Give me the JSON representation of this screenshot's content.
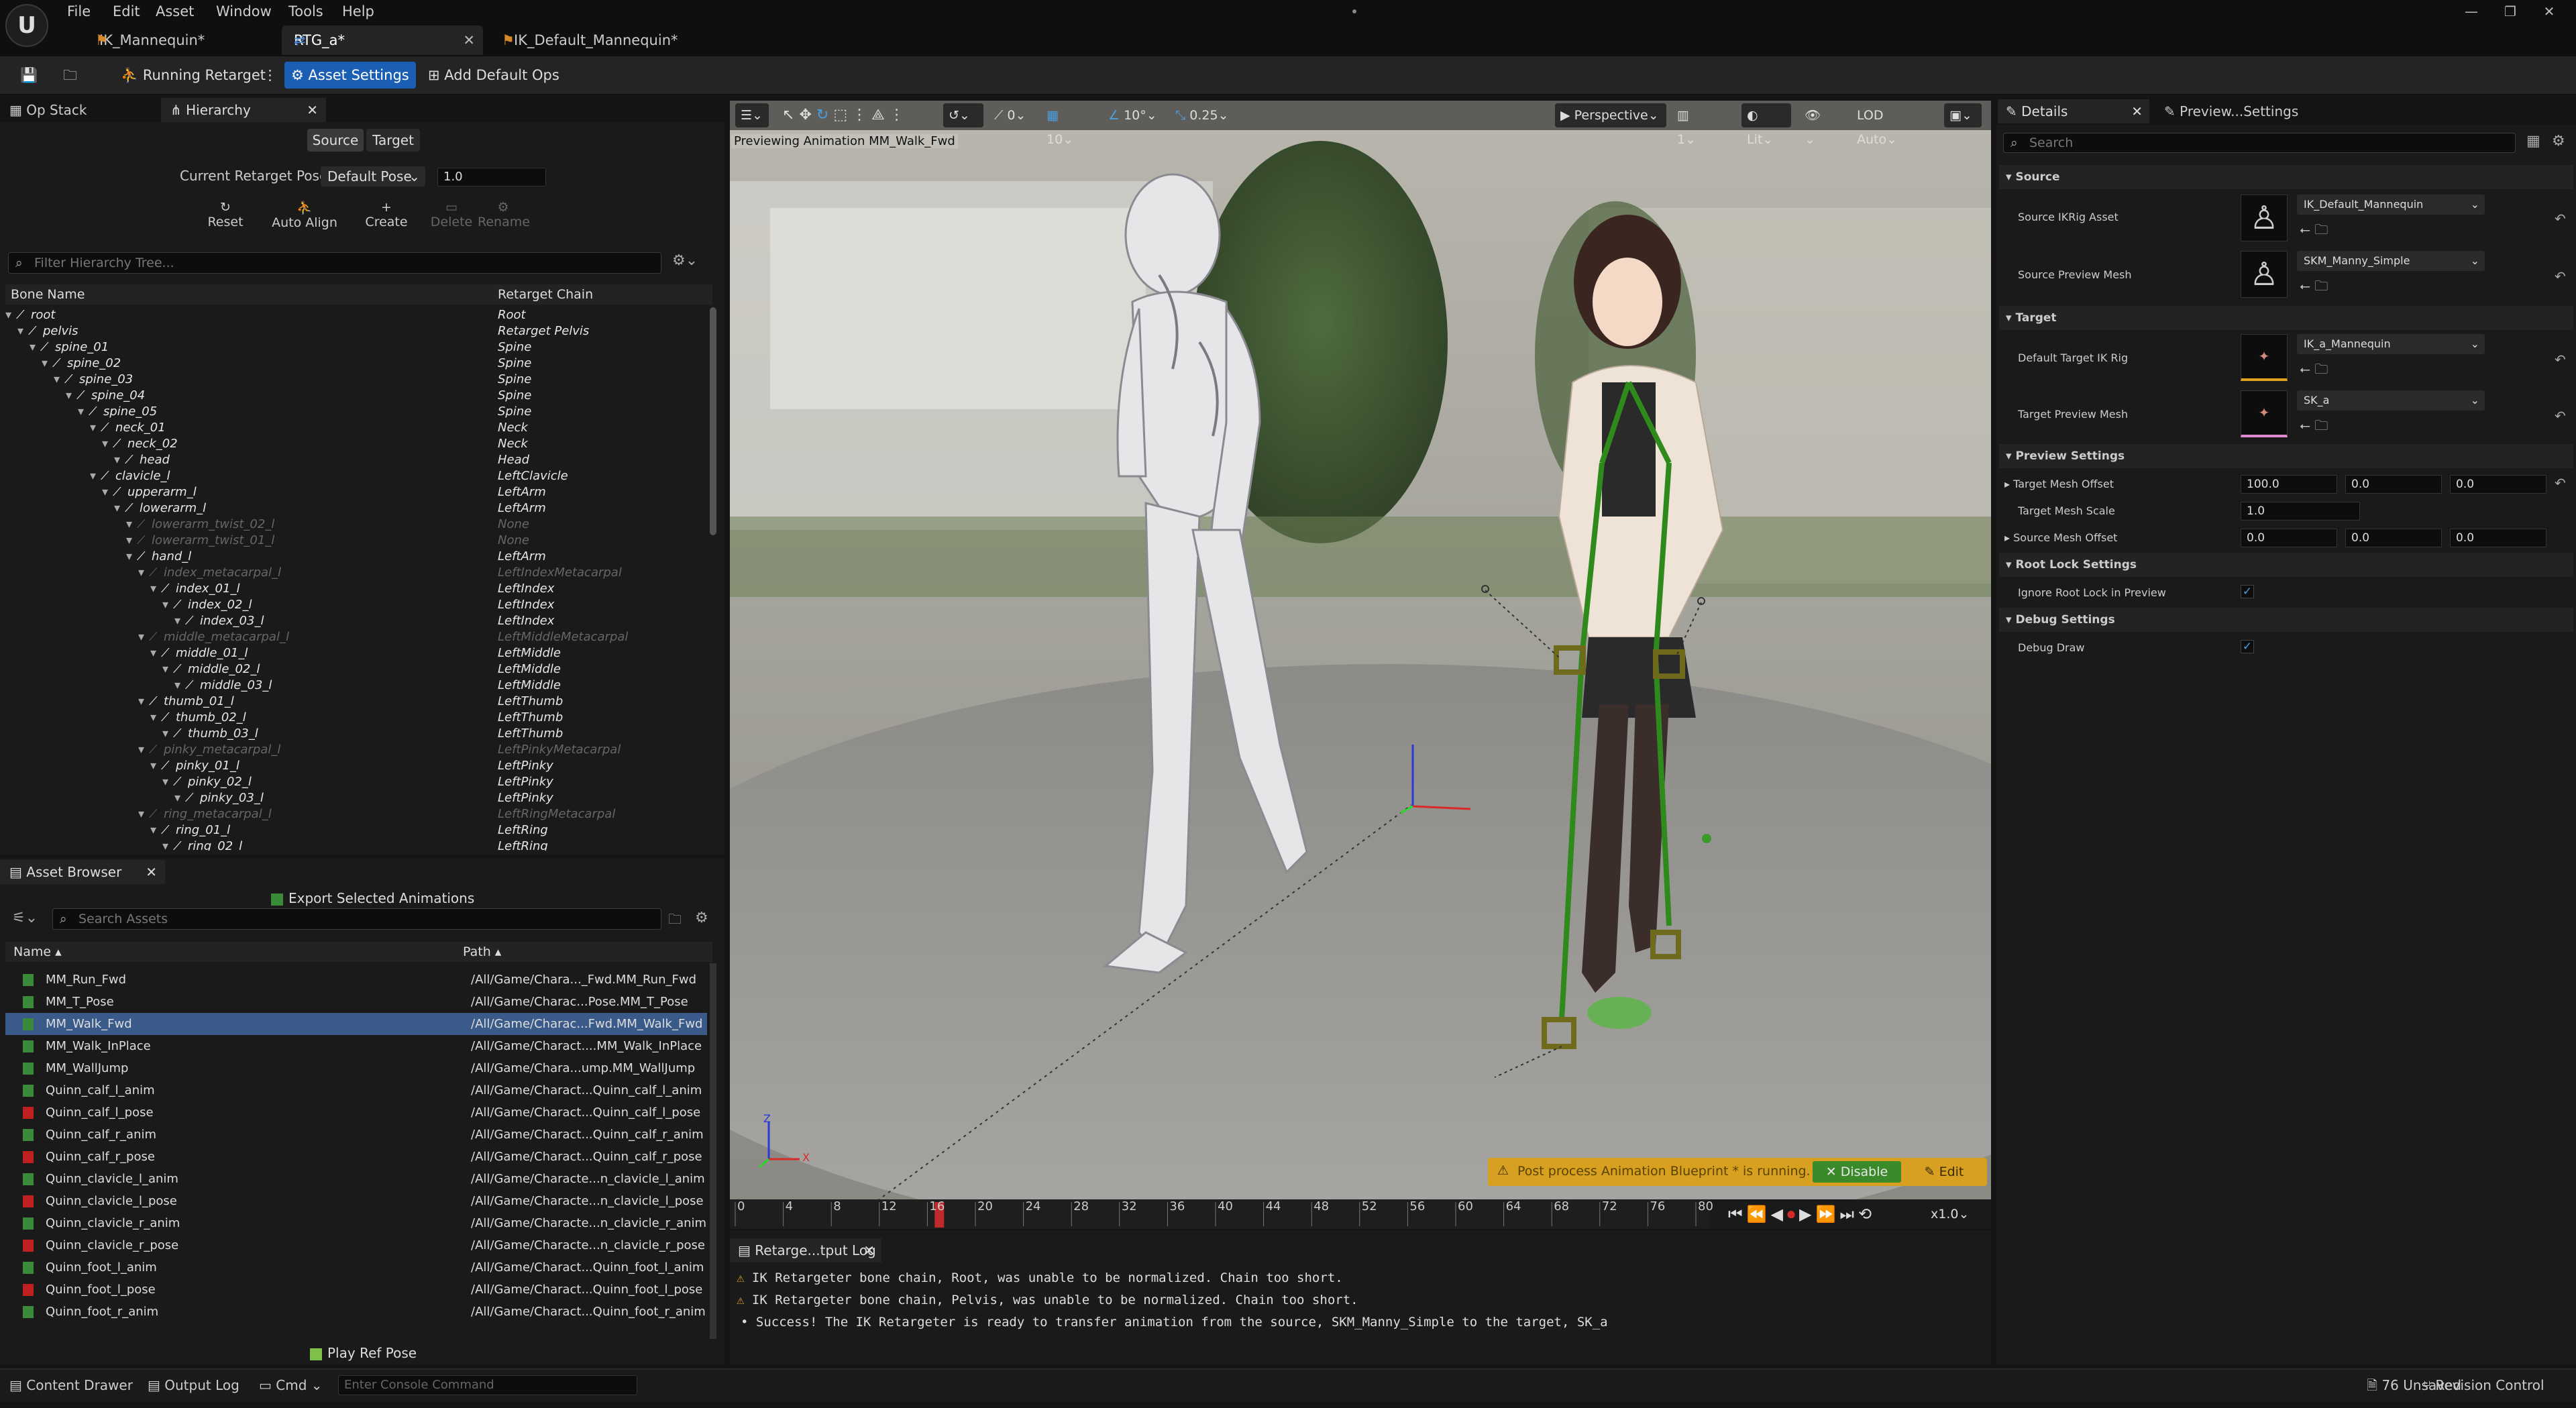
{
  "menu": [
    "File",
    "Edit",
    "Asset",
    "Window",
    "Tools",
    "Help"
  ],
  "tabs": [
    {
      "label": "IK_Mannequin*"
    },
    {
      "label": "RTG_a*"
    },
    {
      "label": "IK_Default_Mannequin*"
    }
  ],
  "toolbar": {
    "running_retarget": "Running Retarget",
    "asset_settings": "Asset Settings",
    "add_default_ops": "Add Default Ops"
  },
  "left_panel": {
    "tab_opstack": "Op Stack",
    "tab_hierarchy": "Hierarchy",
    "source": "Source",
    "target": "Target",
    "current_pose_label": "Current Retarget Pose:",
    "current_pose_value": "Default Pose",
    "pose_blend": "1.0",
    "tools": [
      "Reset",
      "Auto Align",
      "Create",
      "Delete",
      "Rename"
    ],
    "filter_placeholder": "Filter Hierarchy Tree...",
    "col_bone": "Bone Name",
    "col_chain": "Retarget Chain"
  },
  "bones": [
    {
      "name": "root",
      "chain": "Root",
      "depth": 0,
      "dim": false
    },
    {
      "name": "pelvis",
      "chain": "Retarget Pelvis",
      "depth": 1,
      "dim": false
    },
    {
      "name": "spine_01",
      "chain": "Spine",
      "depth": 2,
      "dim": false
    },
    {
      "name": "spine_02",
      "chain": "Spine",
      "depth": 3,
      "dim": false
    },
    {
      "name": "spine_03",
      "chain": "Spine",
      "depth": 4,
      "dim": false
    },
    {
      "name": "spine_04",
      "chain": "Spine",
      "depth": 5,
      "dim": false
    },
    {
      "name": "spine_05",
      "chain": "Spine",
      "depth": 6,
      "dim": false
    },
    {
      "name": "neck_01",
      "chain": "Neck",
      "depth": 7,
      "dim": false
    },
    {
      "name": "neck_02",
      "chain": "Neck",
      "depth": 8,
      "dim": false
    },
    {
      "name": "head",
      "chain": "Head",
      "depth": 9,
      "dim": false
    },
    {
      "name": "clavicle_l",
      "chain": "LeftClavicle",
      "depth": 7,
      "dim": false
    },
    {
      "name": "upperarm_l",
      "chain": "LeftArm",
      "depth": 8,
      "dim": false
    },
    {
      "name": "lowerarm_l",
      "chain": "LeftArm",
      "depth": 9,
      "dim": false
    },
    {
      "name": "lowerarm_twist_02_l",
      "chain": "None",
      "depth": 10,
      "dim": true
    },
    {
      "name": "lowerarm_twist_01_l",
      "chain": "None",
      "depth": 10,
      "dim": true
    },
    {
      "name": "hand_l",
      "chain": "LeftArm",
      "depth": 10,
      "dim": false
    },
    {
      "name": "index_metacarpal_l",
      "chain": "LeftIndexMetacarpal",
      "depth": 11,
      "dim": true
    },
    {
      "name": "index_01_l",
      "chain": "LeftIndex",
      "depth": 12,
      "dim": false
    },
    {
      "name": "index_02_l",
      "chain": "LeftIndex",
      "depth": 13,
      "dim": false
    },
    {
      "name": "index_03_l",
      "chain": "LeftIndex",
      "depth": 14,
      "dim": false
    },
    {
      "name": "middle_metacarpal_l",
      "chain": "LeftMiddleMetacarpal",
      "depth": 11,
      "dim": true
    },
    {
      "name": "middle_01_l",
      "chain": "LeftMiddle",
      "depth": 12,
      "dim": false
    },
    {
      "name": "middle_02_l",
      "chain": "LeftMiddle",
      "depth": 13,
      "dim": false
    },
    {
      "name": "middle_03_l",
      "chain": "LeftMiddle",
      "depth": 14,
      "dim": false
    },
    {
      "name": "thumb_01_l",
      "chain": "LeftThumb",
      "depth": 11,
      "dim": false
    },
    {
      "name": "thumb_02_l",
      "chain": "LeftThumb",
      "depth": 12,
      "dim": false
    },
    {
      "name": "thumb_03_l",
      "chain": "LeftThumb",
      "depth": 13,
      "dim": false
    },
    {
      "name": "pinky_metacarpal_l",
      "chain": "LeftPinkyMetacarpal",
      "depth": 11,
      "dim": true
    },
    {
      "name": "pinky_01_l",
      "chain": "LeftPinky",
      "depth": 12,
      "dim": false
    },
    {
      "name": "pinky_02_l",
      "chain": "LeftPinky",
      "depth": 13,
      "dim": false
    },
    {
      "name": "pinky_03_l",
      "chain": "LeftPinky",
      "depth": 14,
      "dim": false
    },
    {
      "name": "ring_metacarpal_l",
      "chain": "LeftRingMetacarpal",
      "depth": 11,
      "dim": true
    },
    {
      "name": "ring_01_l",
      "chain": "LeftRing",
      "depth": 12,
      "dim": false
    },
    {
      "name": "ring_02_l",
      "chain": "LeftRing",
      "depth": 13,
      "dim": false
    }
  ],
  "asset_browser": {
    "tab": "Asset Browser",
    "export": "Export Selected Animations",
    "search_placeholder": "Search Assets",
    "col_name": "Name",
    "col_path": "Path",
    "play_ref_pose": "Play Ref Pose"
  },
  "assets": [
    {
      "name": "MM_Run_Fwd",
      "path": "/All/Game/Chara..._Fwd.MM_Run_Fwd",
      "color": "#3a8a3a",
      "selected": false
    },
    {
      "name": "MM_T_Pose",
      "path": "/All/Game/Charac...Pose.MM_T_Pose",
      "color": "#3a8a3a",
      "selected": false
    },
    {
      "name": "MM_Walk_Fwd",
      "path": "/All/Game/Charac...Fwd.MM_Walk_Fwd",
      "color": "#3a8a3a",
      "selected": true
    },
    {
      "name": "MM_Walk_InPlace",
      "path": "/All/Game/Charact....MM_Walk_InPlace",
      "color": "#3a8a3a",
      "selected": false
    },
    {
      "name": "MM_WallJump",
      "path": "/All/Game/Chara...ump.MM_WallJump",
      "color": "#3a8a3a",
      "selected": false
    },
    {
      "name": "Quinn_calf_l_anim",
      "path": "/All/Game/Charact...Quinn_calf_l_anim",
      "color": "#3a8a3a",
      "selected": false
    },
    {
      "name": "Quinn_calf_l_pose",
      "path": "/All/Game/Charact...Quinn_calf_l_pose",
      "color": "#c02020",
      "selected": false
    },
    {
      "name": "Quinn_calf_r_anim",
      "path": "/All/Game/Charact...Quinn_calf_r_anim",
      "color": "#3a8a3a",
      "selected": false
    },
    {
      "name": "Quinn_calf_r_pose",
      "path": "/All/Game/Charact...Quinn_calf_r_pose",
      "color": "#c02020",
      "selected": false
    },
    {
      "name": "Quinn_clavicle_l_anim",
      "path": "/All/Game/Characte...n_clavicle_l_anim",
      "color": "#3a8a3a",
      "selected": false
    },
    {
      "name": "Quinn_clavicle_l_pose",
      "path": "/All/Game/Characte...n_clavicle_l_pose",
      "color": "#c02020",
      "selected": false
    },
    {
      "name": "Quinn_clavicle_r_anim",
      "path": "/All/Game/Characte...n_clavicle_r_anim",
      "color": "#3a8a3a",
      "selected": false
    },
    {
      "name": "Quinn_clavicle_r_pose",
      "path": "/All/Game/Characte...n_clavicle_r_pose",
      "color": "#c02020",
      "selected": false
    },
    {
      "name": "Quinn_foot_l_anim",
      "path": "/All/Game/Charact...Quinn_foot_l_anim",
      "color": "#3a8a3a",
      "selected": false
    },
    {
      "name": "Quinn_foot_l_pose",
      "path": "/All/Game/Charact...Quinn_foot_l_pose",
      "color": "#c02020",
      "selected": false
    },
    {
      "name": "Quinn_foot_r_anim",
      "path": "/All/Game/Charact...Quinn_foot_r_anim",
      "color": "#3a8a3a",
      "selected": false
    }
  ],
  "viewport": {
    "snap_rot": "0",
    "snap_grid": "10",
    "snap_angle": "10°",
    "snap_scale": "0.25",
    "perspective": "Perspective",
    "lit": "Lit",
    "lod": "LOD Auto",
    "caption": "Previewing Animation MM_Walk_Fwd",
    "warning": "Post process Animation Blueprint * is running.",
    "disable": "Disable",
    "edit": "Edit"
  },
  "timeline": {
    "ticks": [
      "0",
      "4",
      "8",
      "12",
      "16",
      "20",
      "24",
      "28",
      "32",
      "36",
      "40",
      "44",
      "48",
      "52",
      "56",
      "60",
      "64",
      "68",
      "72",
      "76",
      "80"
    ],
    "current_frame": 17,
    "speed": "x1.0"
  },
  "log": {
    "tab": "Retarge...tput Log",
    "lines": [
      "IK Retargeter bone chain, Root, was unable to be normalized. Chain too short.",
      "IK Retargeter bone chain, Pelvis, was unable to be normalized. Chain too short.",
      "Success! The IK Retargeter is ready to transfer animation from the source, SKM_Manny_Simple to the target, SK_a"
    ]
  },
  "details": {
    "tab_details": "Details",
    "tab_preview": "Preview...Settings",
    "search_placeholder": "Search",
    "sec_source": "Source",
    "source_ikrig_label": "Source IKRig Asset",
    "source_ikrig_value": "IK_Default_Mannequin",
    "source_mesh_label": "Source Preview Mesh",
    "source_mesh_value": "SKM_Manny_Simple",
    "sec_target": "Target",
    "target_ikrig_label": "Default Target IK Rig",
    "target_ikrig_value": "IK_a_Mannequin",
    "target_mesh_label": "Target Preview Mesh",
    "target_mesh_value": "SK_a",
    "sec_preview": "Preview Settings",
    "target_offset_label": "Target Mesh Offset",
    "target_offset": [
      "100.0",
      "0.0",
      "0.0"
    ],
    "target_scale_label": "Target Mesh Scale",
    "target_scale": "1.0",
    "source_offset_label": "Source Mesh Offset",
    "source_offset": [
      "0.0",
      "0.0",
      "0.0"
    ],
    "sec_rootlock": "Root Lock Settings",
    "ignore_root_label": "Ignore Root Lock in Preview",
    "ignore_root": true,
    "sec_debug": "Debug Settings",
    "debug_draw_label": "Debug Draw",
    "debug_draw": true
  },
  "statusbar": {
    "content_drawer": "Content Drawer",
    "output_log": "Output Log",
    "cmd": "Cmd",
    "console_placeholder": "Enter Console Command",
    "unsaved": "76 Unsaved",
    "revision": "Revision Control"
  }
}
